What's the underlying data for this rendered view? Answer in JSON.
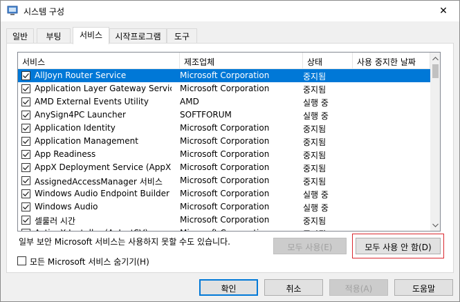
{
  "window": {
    "title": "시스템 구성",
    "close_glyph": "✕"
  },
  "tabs": [
    {
      "label": "일반"
    },
    {
      "label": "부팅"
    },
    {
      "label": "서비스",
      "active": true
    },
    {
      "label": "시작프로그램"
    },
    {
      "label": "도구"
    }
  ],
  "services": {
    "columns": {
      "service": "서비스",
      "manufacturer": "제조업체",
      "status": "상태",
      "date_disabled": "사용 중지한 날짜"
    },
    "rows": [
      {
        "checked": true,
        "name": "AllJoyn Router Service",
        "manufacturer": "Microsoft Corporation",
        "status": "중지됨",
        "date": "",
        "selected": true
      },
      {
        "checked": true,
        "name": "Application Layer Gateway Service",
        "manufacturer": "Microsoft Corporation",
        "status": "중지됨",
        "date": ""
      },
      {
        "checked": true,
        "name": "AMD External Events Utility",
        "manufacturer": "AMD",
        "status": "실행 중",
        "date": ""
      },
      {
        "checked": true,
        "name": "AnySign4PC Launcher",
        "manufacturer": "SOFTFORUM",
        "status": "실행 중",
        "date": ""
      },
      {
        "checked": true,
        "name": "Application Identity",
        "manufacturer": "Microsoft Corporation",
        "status": "중지됨",
        "date": ""
      },
      {
        "checked": true,
        "name": "Application Management",
        "manufacturer": "Microsoft Corporation",
        "status": "중지됨",
        "date": ""
      },
      {
        "checked": true,
        "name": "App Readiness",
        "manufacturer": "Microsoft Corporation",
        "status": "중지됨",
        "date": ""
      },
      {
        "checked": true,
        "name": "AppX Deployment Service (AppXSV...",
        "manufacturer": "Microsoft Corporation",
        "status": "중지됨",
        "date": ""
      },
      {
        "checked": true,
        "name": "AssignedAccessManager 서비스",
        "manufacturer": "Microsoft Corporation",
        "status": "중지됨",
        "date": ""
      },
      {
        "checked": true,
        "name": "Windows Audio Endpoint Builder",
        "manufacturer": "Microsoft Corporation",
        "status": "실행 중",
        "date": ""
      },
      {
        "checked": true,
        "name": "Windows Audio",
        "manufacturer": "Microsoft Corporation",
        "status": "실행 중",
        "date": ""
      },
      {
        "checked": true,
        "name": "셀룰러 시간",
        "manufacturer": "Microsoft Corporation",
        "status": "중지됨",
        "date": ""
      },
      {
        "checked": true,
        "name": "ActiveX Installer (AxInstSV)",
        "manufacturer": "Microsoft Corporation",
        "status": "중지됨",
        "date": ""
      }
    ]
  },
  "notice": "일부 보안 Microsoft 서비스는 사용하지 못할 수도 있습니다.",
  "buttons": {
    "enable_all": "모두 사용(E)",
    "disable_all": "모두 사용 안 함(D)",
    "ok": "확인",
    "cancel": "취소",
    "apply": "적용(A)",
    "help": "도움말"
  },
  "hide_ms": {
    "label": "모든 Microsoft 서비스 숨기기(H)",
    "checked": false
  },
  "colors": {
    "selection": "#0078d7",
    "highlight_border": "#d9272e"
  }
}
